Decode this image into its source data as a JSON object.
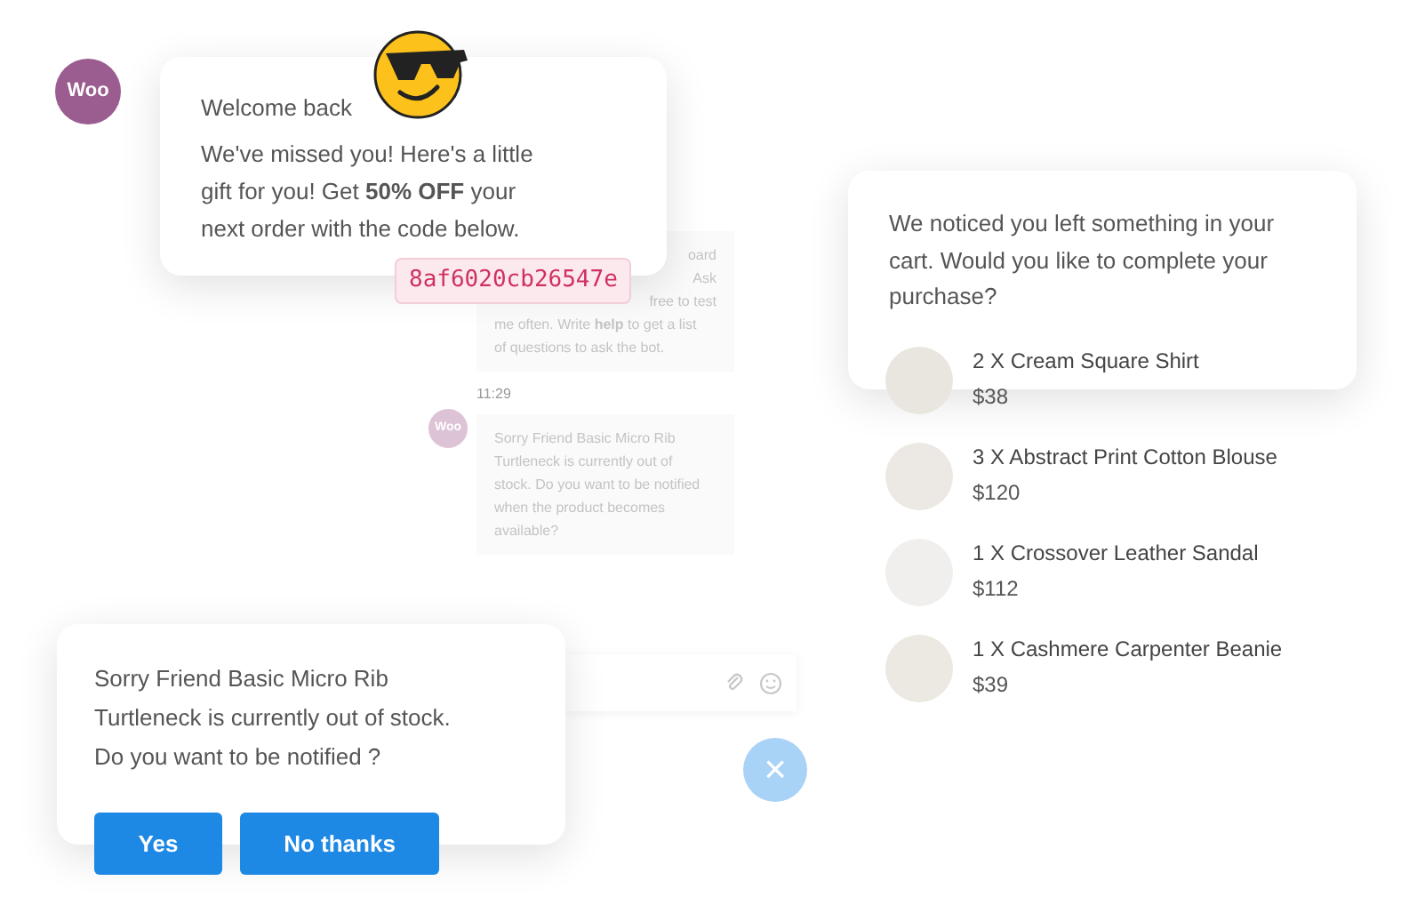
{
  "brand_avatar": {
    "label": "Woo"
  },
  "welcome_card": {
    "title": "Welcome back",
    "message": "We've missed you! Here's a little gift for you! Get **50% OFF** your next order with the code below.",
    "coupon_code": "8af6020cb26547e"
  },
  "background_chat": {
    "messages": [
      {
        "kind": "text",
        "lines": [
          "oard",
          "Ask",
          "free to test",
          "me often. Write **help** to get a list",
          "of questions to ask the bot."
        ]
      },
      {
        "kind": "time",
        "text": "11:29"
      },
      {
        "kind": "bot",
        "avatar": "Woo",
        "lines": [
          "Sorry Friend Basic Micro Rib",
          "Turtleneck is currently out of",
          "stock. Do you want to be notified",
          "when the product becomes",
          "available?"
        ]
      }
    ]
  },
  "cart_card": {
    "message": "We noticed you left something in your cart. Would you like to complete your purchase?",
    "items": [
      {
        "name": "2 X Cream Square Shirt",
        "price": "$38"
      },
      {
        "name": "3 X Abstract Print Cotton Blouse",
        "price": "$120"
      },
      {
        "name": "1 X Crossover Leather Sandal",
        "price": "$112"
      },
      {
        "name": "1 X Cashmere Carpenter Beanie",
        "price": "$39"
      }
    ]
  },
  "stock_card": {
    "message": "Sorry Friend Basic Micro Rib Turtleneck is currently out of stock. Do you want to be notified ?",
    "buttons": [
      {
        "label": "Yes"
      },
      {
        "label": "No thanks"
      }
    ]
  },
  "close_button": {
    "icon": "×"
  }
}
